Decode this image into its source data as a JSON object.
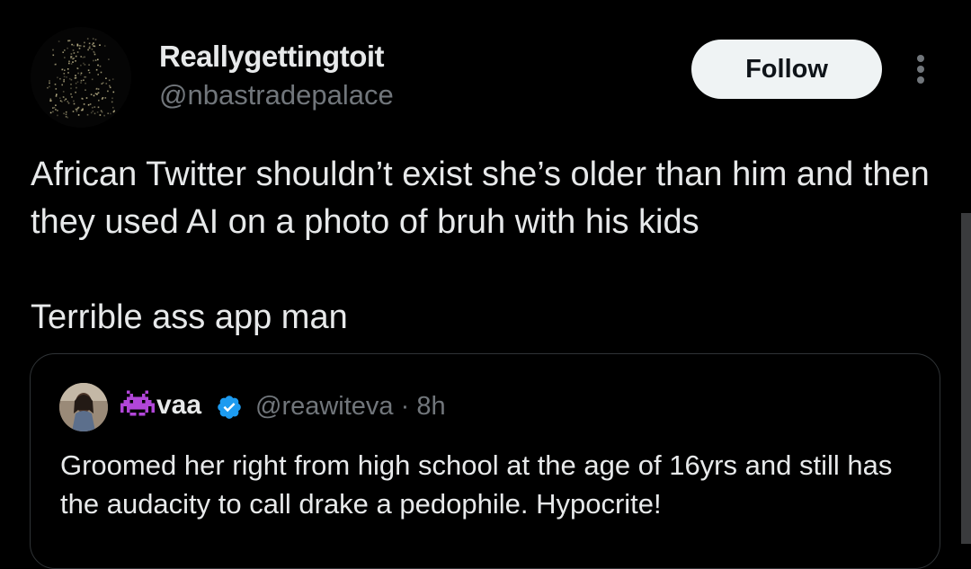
{
  "author": {
    "display_name": "Reallygettingtoit",
    "handle": "@nbastradepalace",
    "avatar_icon": "speckled-dark-avatar"
  },
  "actions": {
    "follow_label": "Follow",
    "more_icon": "more-vertical-icon"
  },
  "tweet": {
    "line1": "African Twitter shouldn’t exist she’s older than him and then they used AI on a photo of bruh with his kids",
    "line2": "Terrible ass app man"
  },
  "quote": {
    "emoji_icon": "space-invader-icon",
    "name": "vaa",
    "verified_icon": "verified-badge-icon",
    "handle_time": "@reawiteva · 8h",
    "text": "Groomed her right from high school at the age of 16yrs and still has the audacity to call drake a pedophile. Hypocrite!"
  },
  "colors": {
    "background": "#000000",
    "primary_text": "#e7e9ea",
    "secondary_text": "#71767b",
    "border": "#2f3336",
    "verified": "#1d9bf0",
    "follow_bg": "#eff3f4",
    "emoji": "#b146d8"
  }
}
